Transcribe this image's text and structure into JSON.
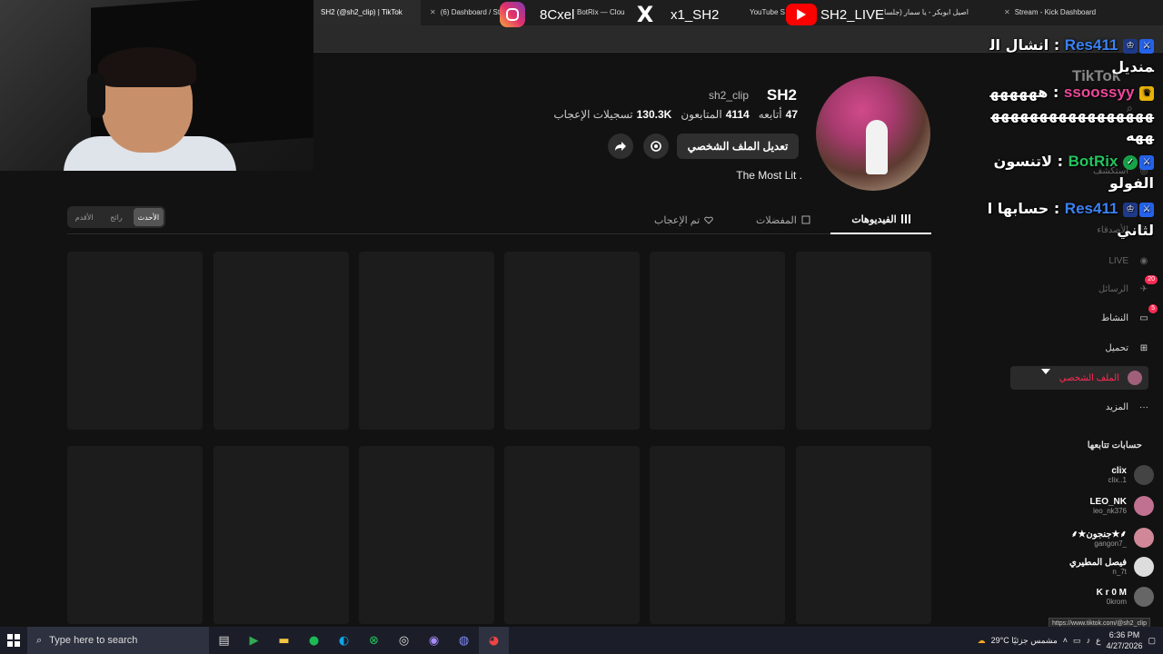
{
  "browser": {
    "tabs": [
      {
        "title": "SH2 (@sh2_clip) | TikTok"
      },
      {
        "title": "(6) Dashboard / St"
      },
      {
        "title": "BotRix — Clou"
      },
      {
        "title": "YouTube S"
      },
      {
        "title": "اصيل ابوبكر - يا سمار (جلسا"
      },
      {
        "title": "Stream - Kick Dashboard"
      }
    ]
  },
  "overlays": {
    "instagram_handle": "8Cxel",
    "x_handle": "x1_SH2",
    "youtube_handle": "SH2_LIVE"
  },
  "profile": {
    "display_name": "SH2",
    "handle": "sh2_clip",
    "following_count": "47",
    "following_label": "أتابعه",
    "followers_count": "4114",
    "followers_label": "المتابعون",
    "likes_count": "130.3K",
    "likes_label": "تسجيلات الإعجاب",
    "edit_button": "تعديل الملف الشخصي",
    "bio": "The Most Lit ."
  },
  "sort": {
    "options": [
      "الأحدث",
      "رائج",
      "الأقدم"
    ],
    "active": "الأحدث"
  },
  "profile_tabs": [
    {
      "label": "الفيديوهات",
      "active": true
    },
    {
      "label": "المفضلات",
      "active": false
    },
    {
      "label": "تم الإعجاب",
      "active": false
    }
  ],
  "sidebar": {
    "logo": "TikTok",
    "nav": [
      {
        "label": "استكشف",
        "icon": "compass-icon",
        "dim": true
      },
      {
        "label": "الأصدقاء",
        "icon": "friends-icon",
        "dim": true
      },
      {
        "label": "LIVE",
        "icon": "live-icon",
        "dim": true
      },
      {
        "label": "الرسائل",
        "icon": "messages-icon",
        "badge": "20",
        "dim": true
      },
      {
        "label": "النشاط",
        "icon": "activity-icon",
        "badge": "5",
        "dim": false
      },
      {
        "label": "تحميل",
        "icon": "upload-icon",
        "dim": false
      },
      {
        "label": "الملف الشخصي",
        "icon": "profile-icon",
        "dim": false,
        "selected": true
      },
      {
        "label": "المزيد",
        "icon": "more-icon",
        "dim": false
      }
    ],
    "following_title": "حسابات تتابعها",
    "following": [
      {
        "name": "clix",
        "handle": "clix..1"
      },
      {
        "name": "LEO_NK",
        "handle": "leo_nk376"
      },
      {
        "name": "⸙★جنجون★⸙",
        "handle": "gangon7_"
      },
      {
        "name": "فيصل المطيري",
        "handle": "n_7t"
      },
      {
        "name": "K r 0 M",
        "handle": "0krom"
      }
    ]
  },
  "chat": [
    {
      "user": "Res411",
      "text": "انشال المنديل",
      "color": "#3b82f6",
      "badges": [
        "mod",
        "og"
      ]
    },
    {
      "user": "ssoossyy",
      "text": "هههههههههههههههههههههههههه",
      "color": "#ec4899",
      "badges": [
        "crown"
      ]
    },
    {
      "user": "BotRix",
      "text": "لاتنسون الفولو",
      "color": "#22c55e",
      "badges": [
        "mod",
        "verified"
      ]
    },
    {
      "user": "Res411",
      "text": "حسابها الثاني",
      "color": "#3b82f6",
      "badges": [
        "mod",
        "og"
      ]
    }
  ],
  "taskbar": {
    "search_placeholder": "Type here to search",
    "weather": "29°C مشمس جزئيًا",
    "lang": "ع",
    "time": "6:36 PM",
    "date": "4/27/2026"
  },
  "status_url": "https://www.tiktok.com/@sh2_clip"
}
